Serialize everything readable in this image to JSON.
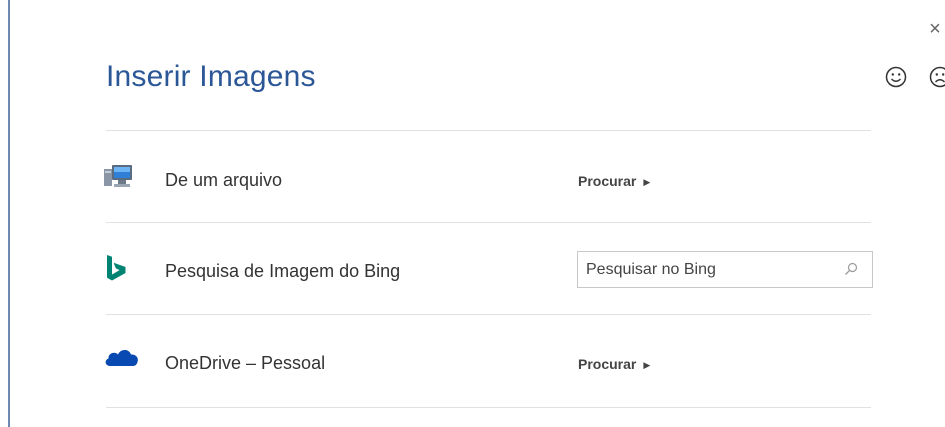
{
  "dialog": {
    "title": "Inserir Imagens",
    "close_label": "×",
    "feedback": {
      "happy_icon": "smiley-happy-icon",
      "sad_icon": "smiley-sad-icon"
    }
  },
  "sources": [
    {
      "icon": "computer-icon",
      "label": "De um arquivo",
      "action_label": "Procurar"
    },
    {
      "icon": "bing-logo-icon",
      "label": "Pesquisa de Imagem do Bing",
      "search_placeholder": "Pesquisar no Bing",
      "search_icon": "magnifier-icon"
    },
    {
      "icon": "onedrive-cloud-icon",
      "label": "OneDrive – Pessoal",
      "action_label": "Procurar"
    }
  ],
  "colors": {
    "title": "#2b5797",
    "bing": "#008373",
    "onedrive": "#094ab2",
    "divider": "#e1e1e1"
  }
}
